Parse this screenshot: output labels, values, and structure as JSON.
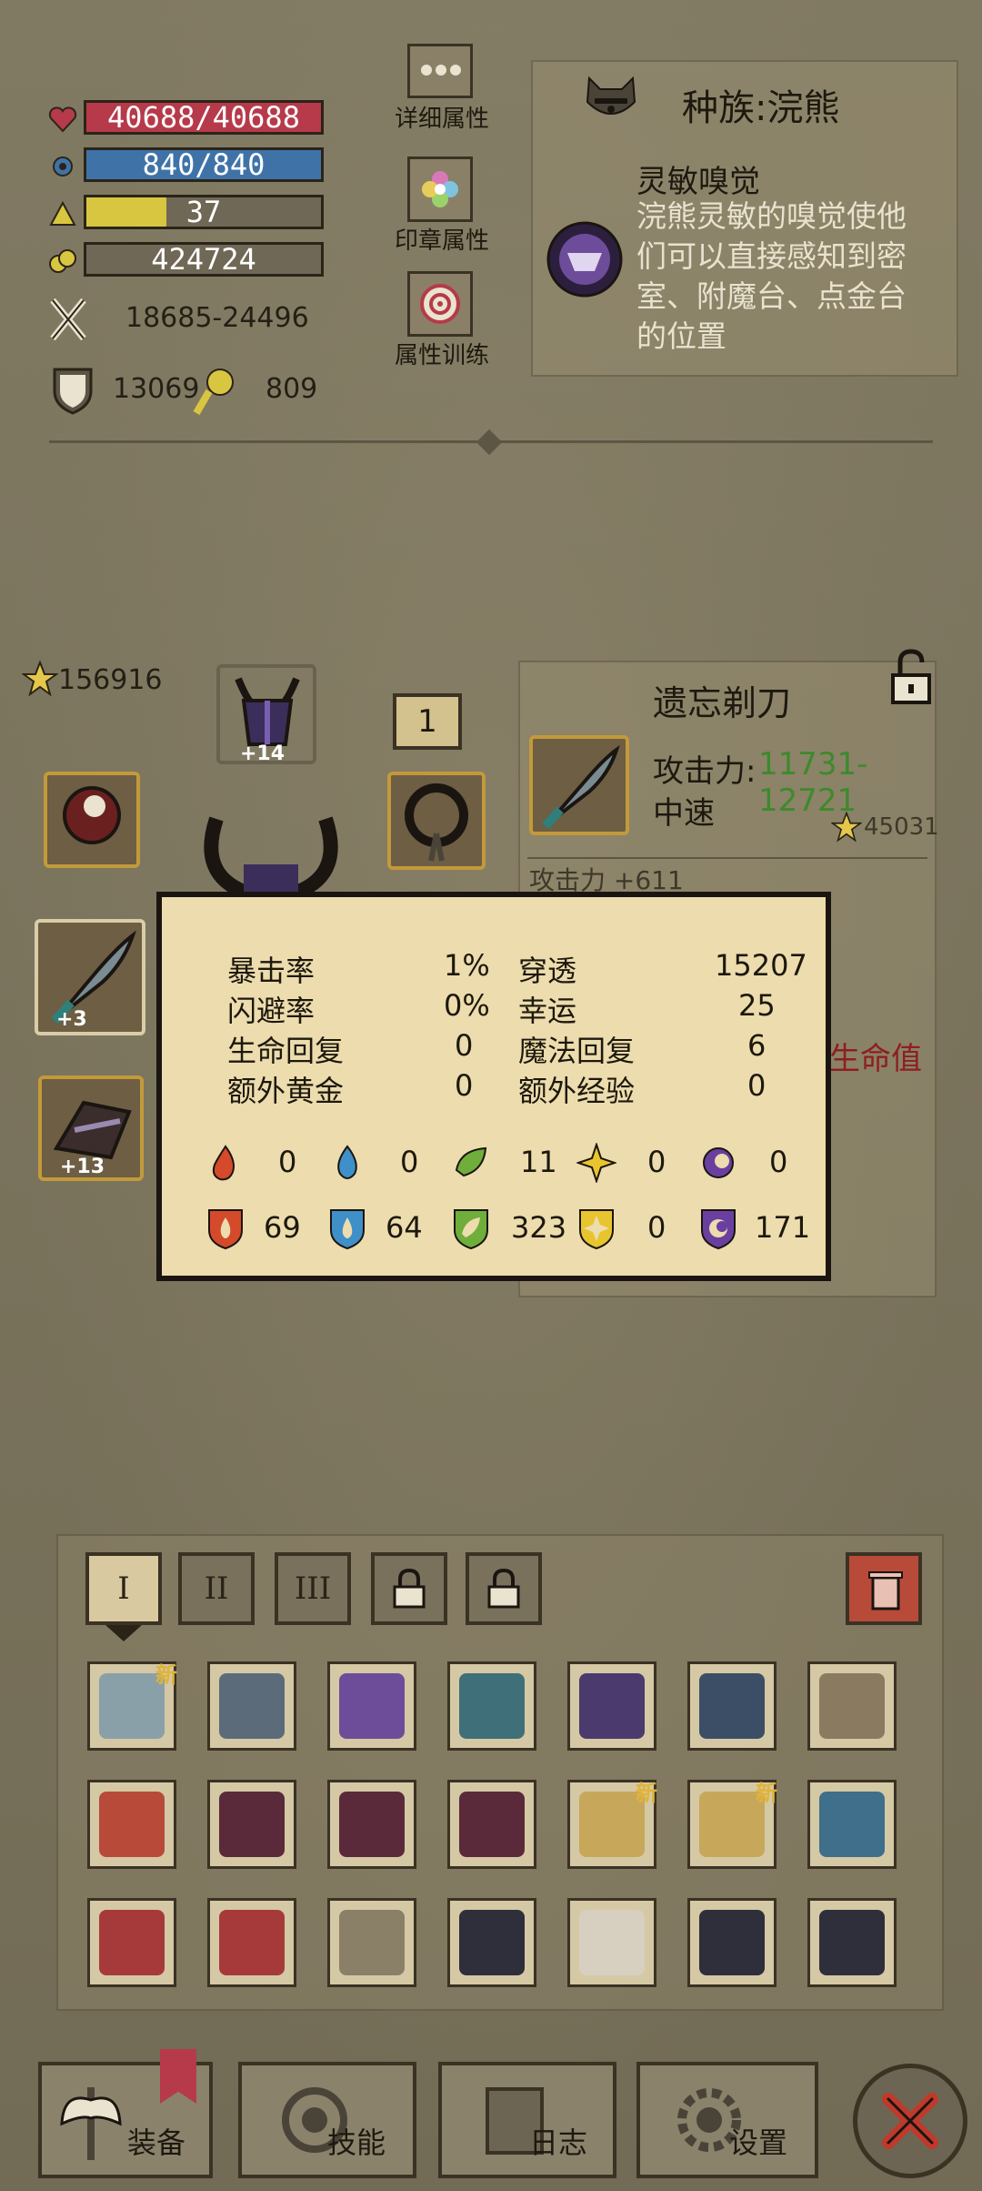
{
  "stats": {
    "hp": "40688/40688",
    "mp": "840/840",
    "level": "37",
    "gold": "424724",
    "level_progress": 0.34,
    "attack": "18685-24496",
    "armor": "13069",
    "luck": "809"
  },
  "menu": {
    "detail_attrs": "详细属性",
    "seal_attrs": "印章属性",
    "attr_training": "属性训练"
  },
  "race": {
    "title": "种族:浣熊",
    "skill_name": "灵敏嗅觉",
    "skill_desc": "浣熊灵敏的嗅觉使他们可以直接感知到密室、附魔台、点金台的位置"
  },
  "equipment": {
    "power": "156916",
    "helmet_plus": "+14",
    "weapon_plus": "+3",
    "glove_plus": "+13",
    "count_box": "1"
  },
  "item": {
    "name": "遗忘剃刀",
    "attack_label": "攻击力:",
    "attack_value": "11731-12721",
    "speed": "中速",
    "power": "45031",
    "bonus": "攻击力 +611",
    "hidden_bonus": "生命值"
  },
  "popup": {
    "rows": [
      {
        "l1": "暴击率",
        "v1": "1%",
        "l2": "穿透",
        "v2": "15207"
      },
      {
        "l1": "闪避率",
        "v1": "0%",
        "l2": "幸运",
        "v2": "25"
      },
      {
        "l1": "生命回复",
        "v1": "0",
        "l2": "魔法回复",
        "v2": "6"
      },
      {
        "l1": "额外黄金",
        "v1": "0",
        "l2": "额外经验",
        "v2": "0"
      }
    ],
    "elem_atk": [
      "0",
      "0",
      "11",
      "0",
      "0"
    ],
    "elem_def": [
      "69",
      "64",
      "323",
      "0",
      "171"
    ]
  },
  "tabs": [
    "I",
    "II",
    "III"
  ],
  "inventory_new_tag": "新",
  "nav": {
    "equip": "装备",
    "skill": "技能",
    "log": "日志",
    "settings": "设置"
  },
  "colors": {
    "hp": "#b63a4a",
    "mp": "#3f73a8",
    "level": "#d9c640",
    "attack_green": "#3d8a2c",
    "popup_bg": "#ecdcae",
    "close_red": "#c0392b"
  }
}
